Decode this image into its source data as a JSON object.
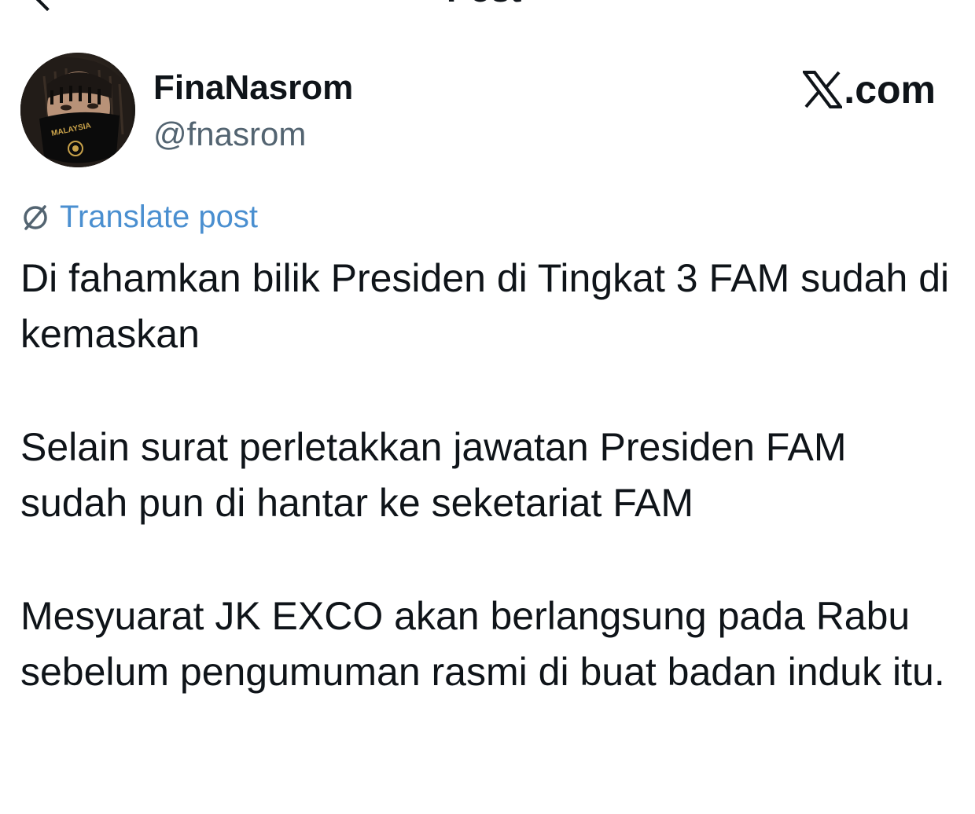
{
  "header": {
    "title": "Post"
  },
  "author": {
    "display_name": "FinaNasrom",
    "handle": "@fnasrom",
    "avatar": "profile-photo",
    "avatar_mask_text": "MALAYSIA"
  },
  "brand": {
    "text": ".com",
    "icon": "x-logo"
  },
  "translate": {
    "label": "Translate post",
    "icon": "globe-slash-icon"
  },
  "post": {
    "paragraphs": [
      "Di fahamkan bilik Presiden di Tingkat 3 FAM sudah di kemaskan",
      "Selain surat perletakkan jawatan Presiden FAM sudah pun di hantar ke seketariat FAM",
      "Mesyuarat JK EXCO akan berlangsung pada Rabu sebelum pengumuman rasmi di buat badan induk itu."
    ]
  },
  "colors": {
    "text": "#0f1419",
    "secondary": "#536471",
    "link": "#4a8fd0"
  }
}
